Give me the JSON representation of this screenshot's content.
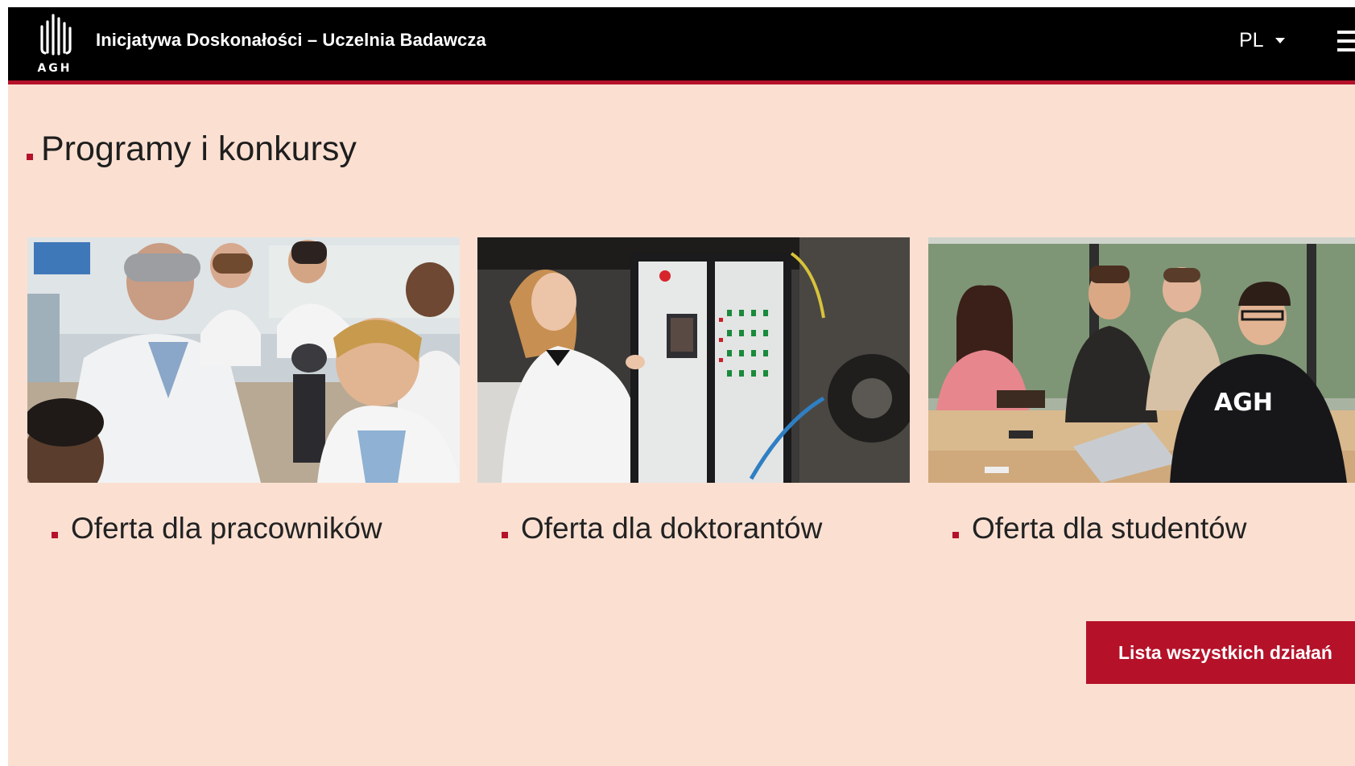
{
  "header": {
    "logo_text": "AGH",
    "site_title": "Inicjatywa Doskonałości – Uczelnia Badawcza",
    "language": "PL",
    "menu_icon": "hamburger-icon"
  },
  "section": {
    "title": "Programy i konkursy"
  },
  "cards": [
    {
      "title": "Oferta dla pracowników",
      "image": "lab-scientists-photo"
    },
    {
      "title": "Oferta dla doktorantów",
      "image": "researcher-control-panel-photo"
    },
    {
      "title": "Oferta dla studentów",
      "image": "students-table-photo"
    }
  ],
  "cta": {
    "label": "Lista wszystkich działań"
  },
  "colors": {
    "header_bg": "#000000",
    "accent": "#b5122a",
    "page_bg": "#fbe0d2",
    "text": "#222222"
  }
}
